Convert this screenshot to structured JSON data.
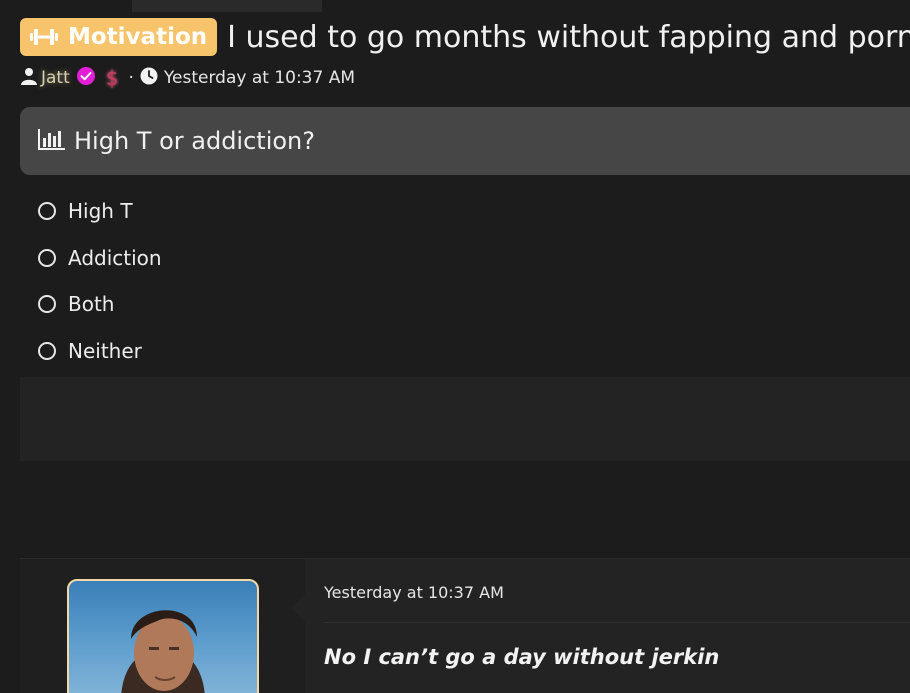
{
  "thread": {
    "prefix": "Motivation",
    "title": "I used to go months without fapping and porn",
    "author": "Jatt",
    "separator": "·",
    "timestamp": "Yesterday at 10:37 AM"
  },
  "poll": {
    "question": "High T or addiction?",
    "options": [
      {
        "label": "High T"
      },
      {
        "label": "Addiction"
      },
      {
        "label": "Both"
      },
      {
        "label": "Neither"
      }
    ]
  },
  "post": {
    "date": "Yesterday at 10:37 AM",
    "body": "No I can’t go a day without jerkin"
  },
  "icons": {
    "prefix": "dumbbell-icon",
    "user": "user-icon",
    "verified": "verified-badge-icon",
    "dollar": "dollar-icon",
    "clock": "clock-icon",
    "poll": "bar-chart-icon",
    "radio": "radio-icon"
  },
  "colors": {
    "background": "#1c1c1c",
    "prefix_badge": "#f7c36b",
    "poll_header": "#464646",
    "verified": "#e21fd6",
    "dollar": "#c93b5a",
    "avatar_border": "#f3d7a6"
  }
}
